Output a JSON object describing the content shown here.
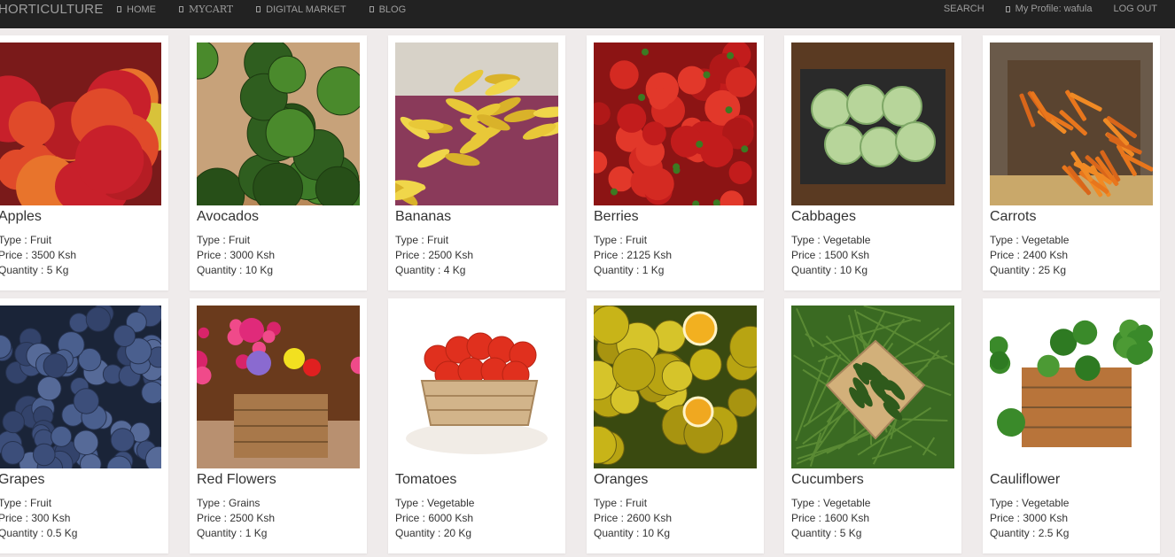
{
  "brand": "HORTICULTURE",
  "nav_left": [
    {
      "label": "HOME",
      "serif": false
    },
    {
      "label": "MYCART",
      "serif": true
    },
    {
      "label": "DIGITAL MARKET",
      "serif": false
    },
    {
      "label": "BLOG",
      "serif": false
    }
  ],
  "nav_right": {
    "search": "SEARCH",
    "profile": "My Profile: wafula",
    "logout": "LOG OUT"
  },
  "labels": {
    "type": "Type : ",
    "price": "Price : ",
    "quantity": "Quantity : "
  },
  "products": [
    {
      "name": "Apples",
      "type": "Fruit",
      "price": "3500 Ksh",
      "quantity": "5 Kg",
      "image": "apples"
    },
    {
      "name": "Avocados",
      "type": "Fruit",
      "price": "3000 Ksh",
      "quantity": "10 Kg",
      "image": "avocados"
    },
    {
      "name": "Bananas",
      "type": "Fruit",
      "price": "2500 Ksh",
      "quantity": "4 Kg",
      "image": "bananas"
    },
    {
      "name": "Berries",
      "type": "Fruit",
      "price": "2125 Ksh",
      "quantity": "1 Kg",
      "image": "berries"
    },
    {
      "name": "Cabbages",
      "type": "Vegetable",
      "price": "1500 Ksh",
      "quantity": "10 Kg",
      "image": "cabbages"
    },
    {
      "name": "Carrots",
      "type": "Vegetable",
      "price": "2400 Ksh",
      "quantity": "25 Kg",
      "image": "carrots"
    },
    {
      "name": "Grapes",
      "type": "Fruit",
      "price": "300 Ksh",
      "quantity": "0.5 Kg",
      "image": "grapes"
    },
    {
      "name": "Red Flowers",
      "type": "Grains",
      "price": "2500 Ksh",
      "quantity": "1 Kg",
      "image": "red-flowers"
    },
    {
      "name": "Tomatoes",
      "type": "Vegetable",
      "price": "6000 Ksh",
      "quantity": "20 Kg",
      "image": "tomatoes"
    },
    {
      "name": "Oranges",
      "type": "Fruit",
      "price": "2600 Ksh",
      "quantity": "10 Kg",
      "image": "oranges"
    },
    {
      "name": "Cucumbers",
      "type": "Vegetable",
      "price": "1600 Ksh",
      "quantity": "5 Kg",
      "image": "cucumbers"
    },
    {
      "name": "Cauliflower",
      "type": "Vegetable",
      "price": "3000 Ksh",
      "quantity": "2.5 Kg",
      "image": "cauliflower"
    }
  ]
}
